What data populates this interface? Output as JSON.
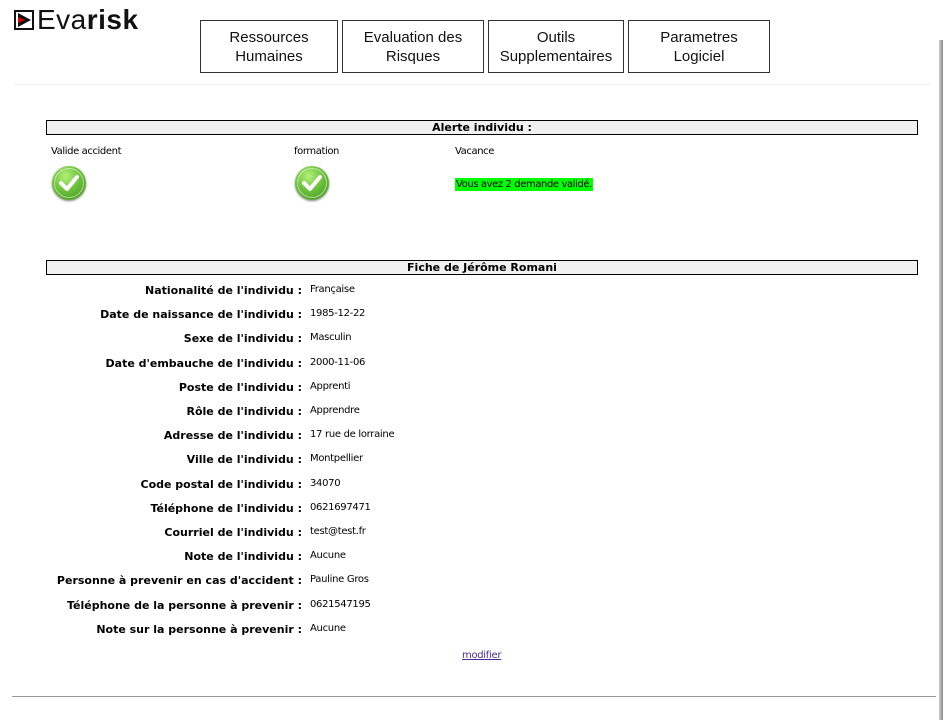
{
  "app": {
    "logo_text_prefix": "Eva",
    "logo_text_bold": "risk",
    "logo_icon": "evarisk-logo-icon"
  },
  "nav": {
    "items": [
      {
        "label": "Ressources\nHumaines"
      },
      {
        "label": "Evaluation des\nRisques"
      },
      {
        "label": "Outils\nSupplementaires"
      },
      {
        "label": "Parametres\nLogiciel"
      }
    ]
  },
  "alert": {
    "title": "Alerte individu :",
    "cols": [
      {
        "label": "Valide accident",
        "icon": "check-icon"
      },
      {
        "label": "formation",
        "icon": "check-icon"
      },
      {
        "label": "Vacance"
      }
    ],
    "vacation_message": "Vous avez 2 demande validé.",
    "vacation_message_bg": "#00ff00"
  },
  "profile": {
    "title": "Fiche de Jérôme Romani",
    "fields": [
      {
        "label": "Nationalité de l'individu :",
        "value": "Française"
      },
      {
        "label": "Date de naissance de l'individu :",
        "value": "1985-12-22"
      },
      {
        "label": "Sexe de l'individu :",
        "value": "Masculin"
      },
      {
        "label": "Date d'embauche de l'individu :",
        "value": "2000-11-06"
      },
      {
        "label": "Poste de l'individu :",
        "value": "Apprenti"
      },
      {
        "label": "Rôle de l'individu :",
        "value": "Apprendre"
      },
      {
        "label": "Adresse de l'individu :",
        "value": "17 rue de lorraine"
      },
      {
        "label": "Ville de l'individu :",
        "value": "Montpellier"
      },
      {
        "label": "Code postal de l'individu :",
        "value": "34070"
      },
      {
        "label": "Téléphone de l'individu :",
        "value": "0621697471"
      },
      {
        "label": "Courriel de l'individu :",
        "value": "test@test.fr"
      },
      {
        "label": "Note de l'individu :",
        "value": "Aucune"
      },
      {
        "label": "Personne à prevenir en cas d'accident :",
        "value": "Pauline Gros"
      },
      {
        "label": "Téléphone de la personne à prevenir :",
        "value": "0621547195"
      },
      {
        "label": "Note sur la personne à prevenir :",
        "value": "Aucune"
      }
    ],
    "modify_link": "modifier",
    "link_color": "#4b2c9a"
  }
}
